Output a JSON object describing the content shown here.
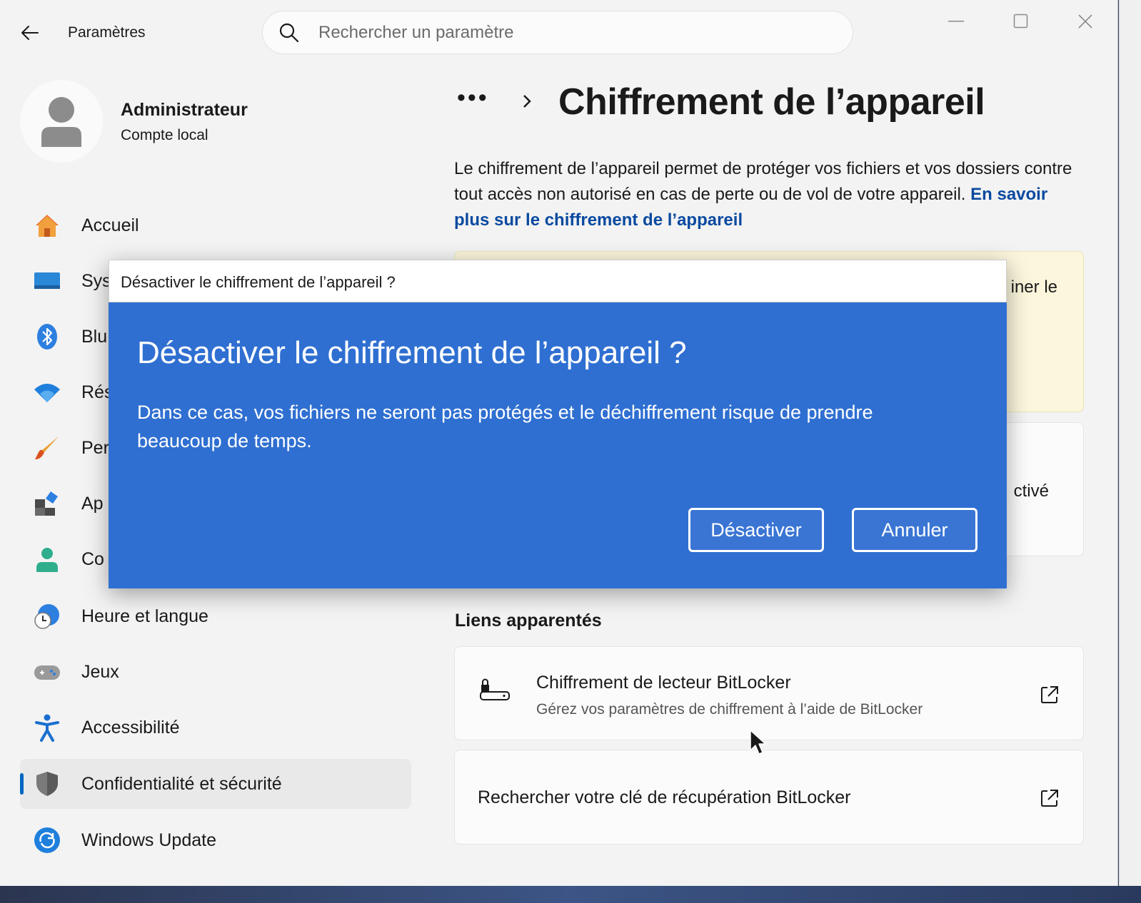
{
  "window": {
    "title": "Paramètres",
    "search_placeholder": "Rechercher un paramètre"
  },
  "user": {
    "name": "Administrateur",
    "account_type": "Compte local"
  },
  "sidebar": {
    "items": [
      {
        "label": "Accueil",
        "icon": "home-icon"
      },
      {
        "label": "Sys",
        "icon": "system-icon"
      },
      {
        "label": "Blu",
        "icon": "bluetooth-icon"
      },
      {
        "label": "Rés",
        "icon": "wifi-icon"
      },
      {
        "label": "Per",
        "icon": "brush-icon"
      },
      {
        "label": "Ap",
        "icon": "apps-icon"
      },
      {
        "label": "Co",
        "icon": "person-icon"
      },
      {
        "label": "Heure et langue",
        "icon": "clock-globe-icon"
      },
      {
        "label": "Jeux",
        "icon": "gamepad-icon"
      },
      {
        "label": "Accessibilité",
        "icon": "accessibility-icon"
      },
      {
        "label": "Confidentialité et sécurité",
        "icon": "shield-icon",
        "active": true
      },
      {
        "label": "Windows Update",
        "icon": "update-icon"
      }
    ]
  },
  "main": {
    "breadcrumb_more": "•••",
    "page_title": "Chiffrement de l’appareil",
    "description": "Le chiffrement de l’appareil permet de protéger vos fichiers et vos dossiers contre tout accès non autorisé en cas de perte ou de vol de votre appareil.",
    "learn_more_link": "En savoir plus sur le chiffrement de l’appareil",
    "warning_partial": "iner le",
    "status_partial": "ctivé",
    "related_links_heading": "Liens apparentés",
    "links": [
      {
        "title": "Chiffrement de lecteur BitLocker",
        "subtitle": "Gérez vos paramètres de chiffrement à l’aide de BitLocker"
      },
      {
        "title": "Rechercher votre clé de récupération BitLocker"
      }
    ]
  },
  "dialog": {
    "window_title": "Désactiver le chiffrement de l’appareil ?",
    "heading": "Désactiver le chiffrement de l’appareil ?",
    "message": "Dans ce cas, vos fichiers ne seront pas protégés et le déchiffrement risque de prendre beaucoup de temps.",
    "confirm_label": "Désactiver",
    "cancel_label": "Annuler"
  },
  "colors": {
    "accent": "#0067c0",
    "dialog_bg": "#2f6fd1",
    "link": "#0a4aa0",
    "warning_bg": "#fbf6dc"
  }
}
